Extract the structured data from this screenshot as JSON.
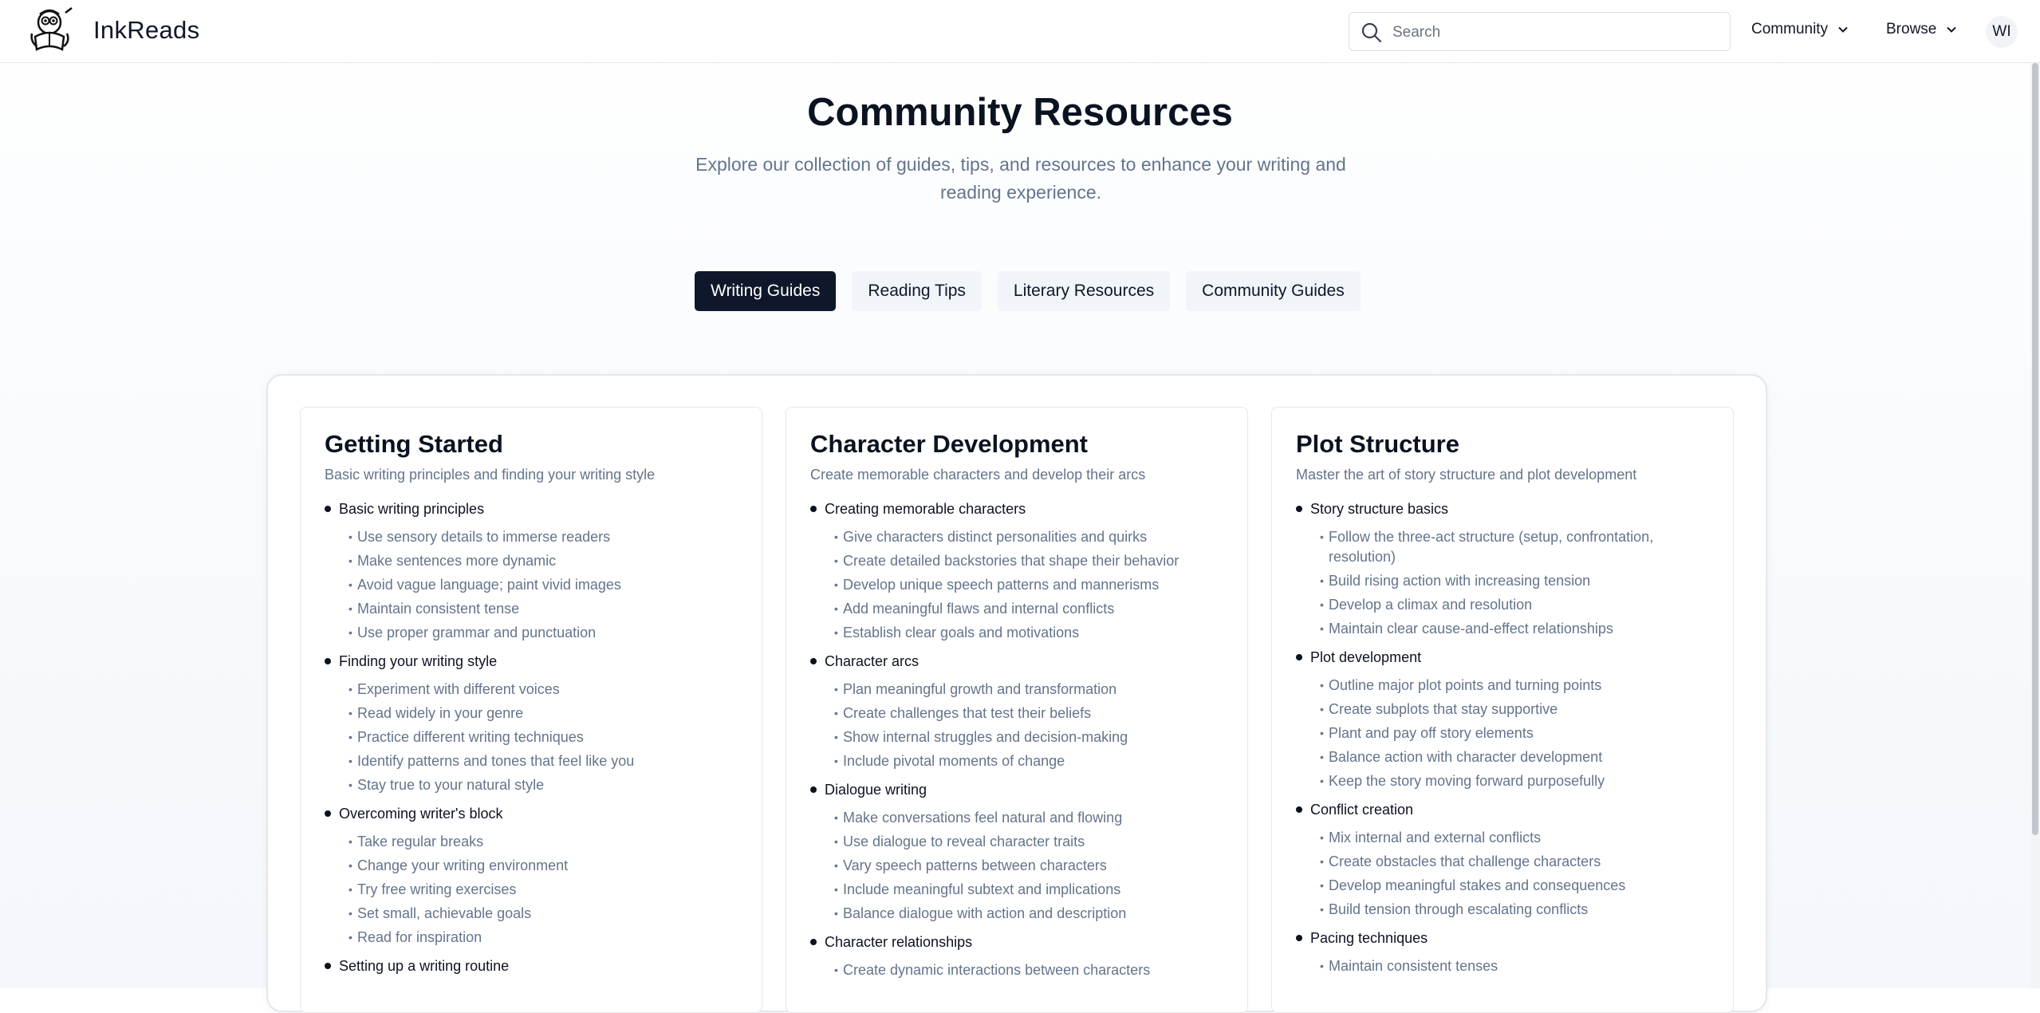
{
  "header": {
    "brand": "InkReads",
    "search_placeholder": "Search",
    "nav": [
      {
        "label": "Community"
      },
      {
        "label": "Browse"
      }
    ],
    "avatar_initials": "WI"
  },
  "hero": {
    "title": "Community Resources",
    "subtitle": "Explore our collection of guides, tips, and resources to enhance your writing and reading experience."
  },
  "tabs": [
    {
      "label": "Writing Guides",
      "active": true
    },
    {
      "label": "Reading Tips",
      "active": false
    },
    {
      "label": "Literary Resources",
      "active": false
    },
    {
      "label": "Community Guides",
      "active": false
    }
  ],
  "cards": [
    {
      "title": "Getting Started",
      "description": "Basic writing principles and finding your writing style",
      "sections": [
        {
          "heading": "Basic writing principles",
          "points": [
            "Use sensory details to immerse readers",
            "Make sentences more dynamic",
            "Avoid vague language; paint vivid images",
            "Maintain consistent tense",
            "Use proper grammar and punctuation"
          ]
        },
        {
          "heading": "Finding your writing style",
          "points": [
            "Experiment with different voices",
            "Read widely in your genre",
            "Practice different writing techniques",
            "Identify patterns and tones that feel like you",
            "Stay true to your natural style"
          ]
        },
        {
          "heading": "Overcoming writer's block",
          "points": [
            "Take regular breaks",
            "Change your writing environment",
            "Try free writing exercises",
            "Set small, achievable goals",
            "Read for inspiration"
          ]
        },
        {
          "heading": "Setting up a writing routine",
          "points": []
        }
      ]
    },
    {
      "title": "Character Development",
      "description": "Create memorable characters and develop their arcs",
      "sections": [
        {
          "heading": "Creating memorable characters",
          "points": [
            "Give characters distinct personalities and quirks",
            "Create detailed backstories that shape their behavior",
            "Develop unique speech patterns and mannerisms",
            "Add meaningful flaws and internal conflicts",
            "Establish clear goals and motivations"
          ]
        },
        {
          "heading": "Character arcs",
          "points": [
            "Plan meaningful growth and transformation",
            "Create challenges that test their beliefs",
            "Show internal struggles and decision-making",
            "Include pivotal moments of change"
          ]
        },
        {
          "heading": "Dialogue writing",
          "points": [
            "Make conversations feel natural and flowing",
            "Use dialogue to reveal character traits",
            "Vary speech patterns between characters",
            "Include meaningful subtext and implications",
            "Balance dialogue with action and description"
          ]
        },
        {
          "heading": "Character relationships",
          "points": [
            "Create dynamic interactions between characters"
          ]
        }
      ]
    },
    {
      "title": "Plot Structure",
      "description": "Master the art of story structure and plot development",
      "sections": [
        {
          "heading": "Story structure basics",
          "points": [
            "Follow the three-act structure (setup, confrontation, resolution)",
            "Build rising action with increasing tension",
            "Develop a climax and resolution",
            "Maintain clear cause-and-effect relationships"
          ]
        },
        {
          "heading": "Plot development",
          "points": [
            "Outline major plot points and turning points",
            "Create subplots that stay supportive",
            "Plant and pay off story elements",
            "Balance action with character development",
            "Keep the story moving forward purposefully"
          ]
        },
        {
          "heading": "Conflict creation",
          "points": [
            "Mix internal and external conflicts",
            "Create obstacles that challenge characters",
            "Develop meaningful stakes and consequences",
            "Build tension through escalating conflicts"
          ]
        },
        {
          "heading": "Pacing techniques",
          "points": [
            "Maintain consistent tenses"
          ]
        }
      ]
    }
  ]
}
